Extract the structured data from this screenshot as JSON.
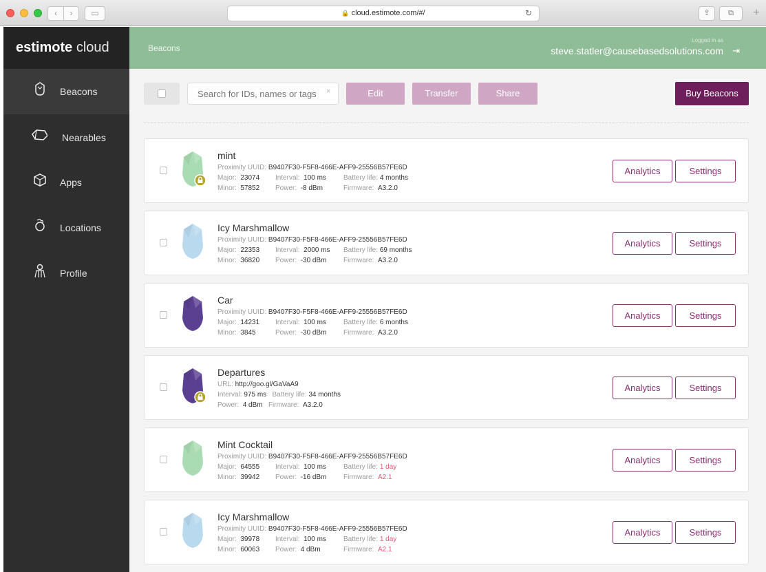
{
  "browser": {
    "url": "cloud.estimote.com/#/",
    "back": "‹",
    "forward": "›",
    "sidebar_toggle": "▭",
    "reload": "↻",
    "share": "⇪",
    "tabs": "⧉",
    "new_tab": "+"
  },
  "sidebar": {
    "logo_bold": "estimote",
    "logo_light": "cloud",
    "items": [
      {
        "label": "Beacons",
        "icon": "beacon-icon",
        "active": true
      },
      {
        "label": "Nearables",
        "icon": "nearables-icon",
        "active": false
      },
      {
        "label": "Apps",
        "icon": "apps-icon",
        "active": false
      },
      {
        "label": "Locations",
        "icon": "locations-icon",
        "active": false
      },
      {
        "label": "Profile",
        "icon": "profile-icon",
        "active": false
      }
    ]
  },
  "header": {
    "breadcrumb": "Beacons",
    "logged_in_label": "Logged in as",
    "user_email": "steve.statler@causebasedsolutions.com",
    "logout_icon": "⇥"
  },
  "toolbar": {
    "search_placeholder": "Search for IDs, names or tags",
    "search_clear": "×",
    "edit_label": "Edit",
    "transfer_label": "Transfer",
    "share_label": "Share",
    "buy_label": "Buy Beacons"
  },
  "labels": {
    "uuid": "Proximity UUID:",
    "url": "URL:",
    "major": "Major:",
    "minor": "Minor:",
    "interval": "Interval:",
    "power": "Power:",
    "battery": "Battery life:",
    "firmware": "Firmware:",
    "analytics": "Analytics",
    "settings": "Settings"
  },
  "colors": {
    "mint": "#a9dcb2",
    "ice": "#b9d9ee",
    "purple": "#5b3f91",
    "lock": "#b7a52a",
    "accent": "#8a2e72"
  },
  "beacons": [
    {
      "name": "mint",
      "color": "mint",
      "locked": true,
      "uuid": "B9407F30-F5F8-466E-AFF9-25556B57FE6D",
      "major": "23074",
      "minor": "57852",
      "interval": "100 ms",
      "power": "-8 dBm",
      "battery": "4 months",
      "firmware": "A3.2.0",
      "warn": false
    },
    {
      "name": "Icy Marshmallow",
      "color": "ice",
      "locked": false,
      "uuid": "B9407F30-F5F8-466E-AFF9-25556B57FE6D",
      "major": "22353",
      "minor": "36820",
      "interval": "2000 ms",
      "power": "-30 dBm",
      "battery": "69 months",
      "firmware": "A3.2.0",
      "warn": false
    },
    {
      "name": "Car",
      "color": "purple",
      "locked": false,
      "uuid": "B9407F30-F5F8-466E-AFF9-25556B57FE6D",
      "major": "14231",
      "minor": "3845",
      "interval": "100 ms",
      "power": "-30 dBm",
      "battery": "6 months",
      "firmware": "A3.2.0",
      "warn": false
    },
    {
      "name": "Departures",
      "color": "purple",
      "locked": true,
      "url": "http://goo.gl/GaVaA9",
      "interval": "975 ms",
      "battery": "34 months",
      "power": "4 dBm",
      "firmware": "A3.2.0",
      "warn": false
    },
    {
      "name": "Mint Cocktail",
      "color": "mint",
      "locked": false,
      "uuid": "B9407F30-F5F8-466E-AFF9-25556B57FE6D",
      "major": "64555",
      "minor": "39942",
      "interval": "100 ms",
      "power": "-16 dBm",
      "battery": "1 day",
      "firmware": "A2.1",
      "warn": true
    },
    {
      "name": "Icy Marshmallow",
      "color": "ice",
      "locked": false,
      "uuid": "B9407F30-F5F8-466E-AFF9-25556B57FE6D",
      "major": "39978",
      "minor": "60063",
      "interval": "100 ms",
      "power": "4 dBm",
      "battery": "1 day",
      "firmware": "A2.1",
      "warn": true
    }
  ]
}
